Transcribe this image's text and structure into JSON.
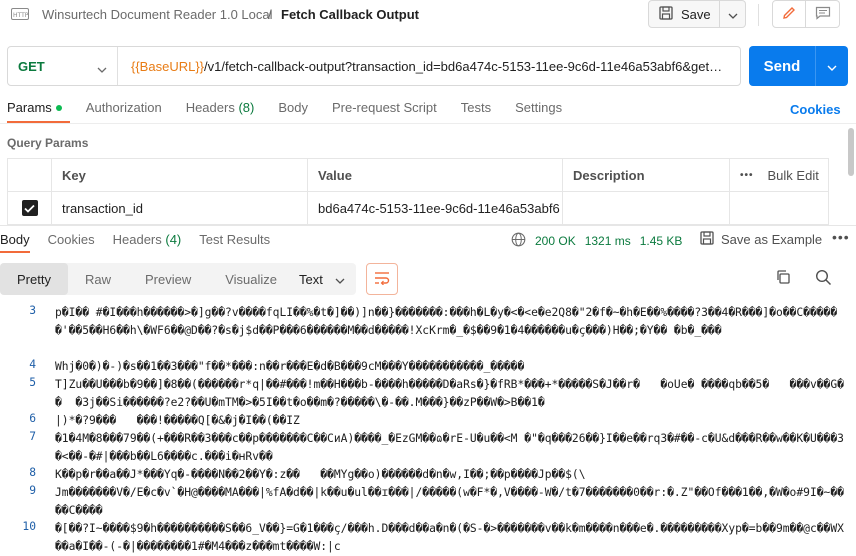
{
  "header": {
    "breadcrumb": "Winsurtech Document Reader 1.0 Local",
    "separator": "/",
    "title": "Fetch Callback Output",
    "save_label": "Save"
  },
  "request": {
    "method": "GET",
    "url_var": "{{BaseURL}}",
    "url_rest": "/v1/fetch-callback-output?transaction_id=bd6a474c-5153-11ee-9c6d-11e46a53abf6&get_p...",
    "send_label": "Send"
  },
  "request_tabs": [
    {
      "label": "Params",
      "active": true
    },
    {
      "label": "Authorization"
    },
    {
      "label": "Headers",
      "count": "(8)"
    },
    {
      "label": "Body"
    },
    {
      "label": "Pre-request Script"
    },
    {
      "label": "Tests"
    },
    {
      "label": "Settings"
    }
  ],
  "cookies_label": "Cookies",
  "query_params": {
    "title": "Query Params",
    "headers": {
      "key": "Key",
      "value": "Value",
      "description": "Description",
      "bulk_edit": "Bulk Edit",
      "more": "•••"
    },
    "rows": [
      {
        "key": "transaction_id",
        "value": "bd6a474c-5153-11ee-9c6d-11e46a53abf6",
        "description": "",
        "checked": true
      }
    ]
  },
  "response_tabs": [
    {
      "label": "Body",
      "active": true
    },
    {
      "label": "Cookies"
    },
    {
      "label": "Headers",
      "count": "(4)"
    },
    {
      "label": "Test Results"
    }
  ],
  "response_meta": {
    "status": "200 OK",
    "time": "1321 ms",
    "size": "1.45 KB",
    "save_example": "Save as Example",
    "more": "•••"
  },
  "format_tabs": [
    "Pretty",
    "Raw",
    "Preview",
    "Visualize"
  ],
  "format_type": "Text",
  "colors": {
    "accent": "#f26b3a",
    "send": "#097bed",
    "method": "#0b7a3e",
    "variable": "#e87c15"
  },
  "code_lines": [
    {
      "num": "3",
      "text": "p�I�� #�I���h������>�]g��?v����fqLI��%�t�]��)]n��}�������:���h�L�y�<�<e�e2Q8�\"2�f�~�h�E��%����?3��4�R���]�o��C������'��5��H6��h\\�WF6��@D��?�s�j$d��P���6������M��d�����!XcKrm�_�$��9�1�4������u�ç���)H��;�Y�� �b�_���"
    },
    {
      "num": "4",
      "text": "Whj�0�)�-)�s��1��3���\"f��*���:n��r���E�d�B���9cM���Y�����������_�����"
    },
    {
      "num": "5",
      "text": "T]Zu��U���b�9��]�8��(������r*q|��#���!m��H���b-����h�����D�aRs�}�fRB*���+*�����S�J��r�   �oUe� ����qb��5�   ���v��G��  �3j��Si������?e2?��U�mTM�>�5I��t�o��m�?�����\\�-��.M���}��zP��W�>B��1�"
    },
    {
      "num": "6",
      "text": "|)*�?9���   ���!�����Q[�&�j�I��(��IZ"
    },
    {
      "num": "7",
      "text": "�1�4M�8���79��(+���R��3���c��p�������C��CиA)����_�EzGM��ɷ�rE-U�u��<M �\"�q���26��}I��e��rq3�#��-c�U&d���R��w��K�U���3�<��-�#|���b��L6����c.���i�ʜRv��"
    },
    {
      "num": "8",
      "text": "K��p�r��a��J*���Yq�-����N��2��Y�:z��   ��MYg��o)������d�n�w,I��;��p����Jp��$(\\"
    },
    {
      "num": "9",
      "text": "Jm�������V�/E�c�v`�H@����MA���|%fA�d��|k��u�ul��ɪ���|/�����(w�F*�,V����-W�/t�7�������0��r:�.Z\"��Of���1��,�W�o#9I�~����C����"
    },
    {
      "num": "10",
      "text": "�[��?I~����$9�h����������S��6_V��}=G�1���ç/���h.D���d��a�n�(�S-�>�������v��k�m����n���e�.���������Xyp�=b��9m��@c��WX��a�I��-(-�|��������1#�M4���z���mt����W:|c"
    }
  ]
}
